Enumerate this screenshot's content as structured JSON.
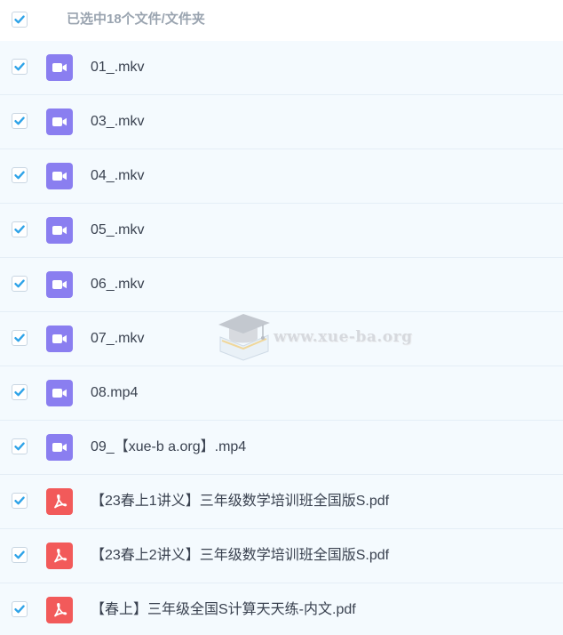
{
  "header": {
    "selection_text": "已选中18个文件/文件夹"
  },
  "colors": {
    "check": "#2ea3e8",
    "video_icon": "#8a7ef0",
    "pdf_icon": "#f25a5a",
    "row_bg": "#f4fafe"
  },
  "files": [
    {
      "name": "01_.mkv",
      "type": "video",
      "icon": "video-camera-icon",
      "checked": true
    },
    {
      "name": "03_.mkv",
      "type": "video",
      "icon": "video-camera-icon",
      "checked": true
    },
    {
      "name": "04_.mkv",
      "type": "video",
      "icon": "video-camera-icon",
      "checked": true
    },
    {
      "name": "05_.mkv",
      "type": "video",
      "icon": "video-camera-icon",
      "checked": true
    },
    {
      "name": "06_.mkv",
      "type": "video",
      "icon": "video-camera-icon",
      "checked": true
    },
    {
      "name": "07_.mkv",
      "type": "video",
      "icon": "video-camera-icon",
      "checked": true
    },
    {
      "name": "08.mp4",
      "type": "video",
      "icon": "video-camera-icon",
      "checked": true
    },
    {
      "name": "09_【xue-b a.org】.mp4",
      "type": "video",
      "icon": "video-camera-icon",
      "checked": true
    },
    {
      "name": "【23春上1讲义】三年级数学培训班全国版S.pdf",
      "type": "pdf",
      "icon": "pdf-icon",
      "checked": true
    },
    {
      "name": "【23春上2讲义】三年级数学培训班全国版S.pdf",
      "type": "pdf",
      "icon": "pdf-icon",
      "checked": true
    },
    {
      "name": "【春上】三年级全国S计算天天练-内文.pdf",
      "type": "pdf",
      "icon": "pdf-icon",
      "checked": true
    }
  ],
  "watermark": {
    "text": "www.xue-ba.org"
  }
}
